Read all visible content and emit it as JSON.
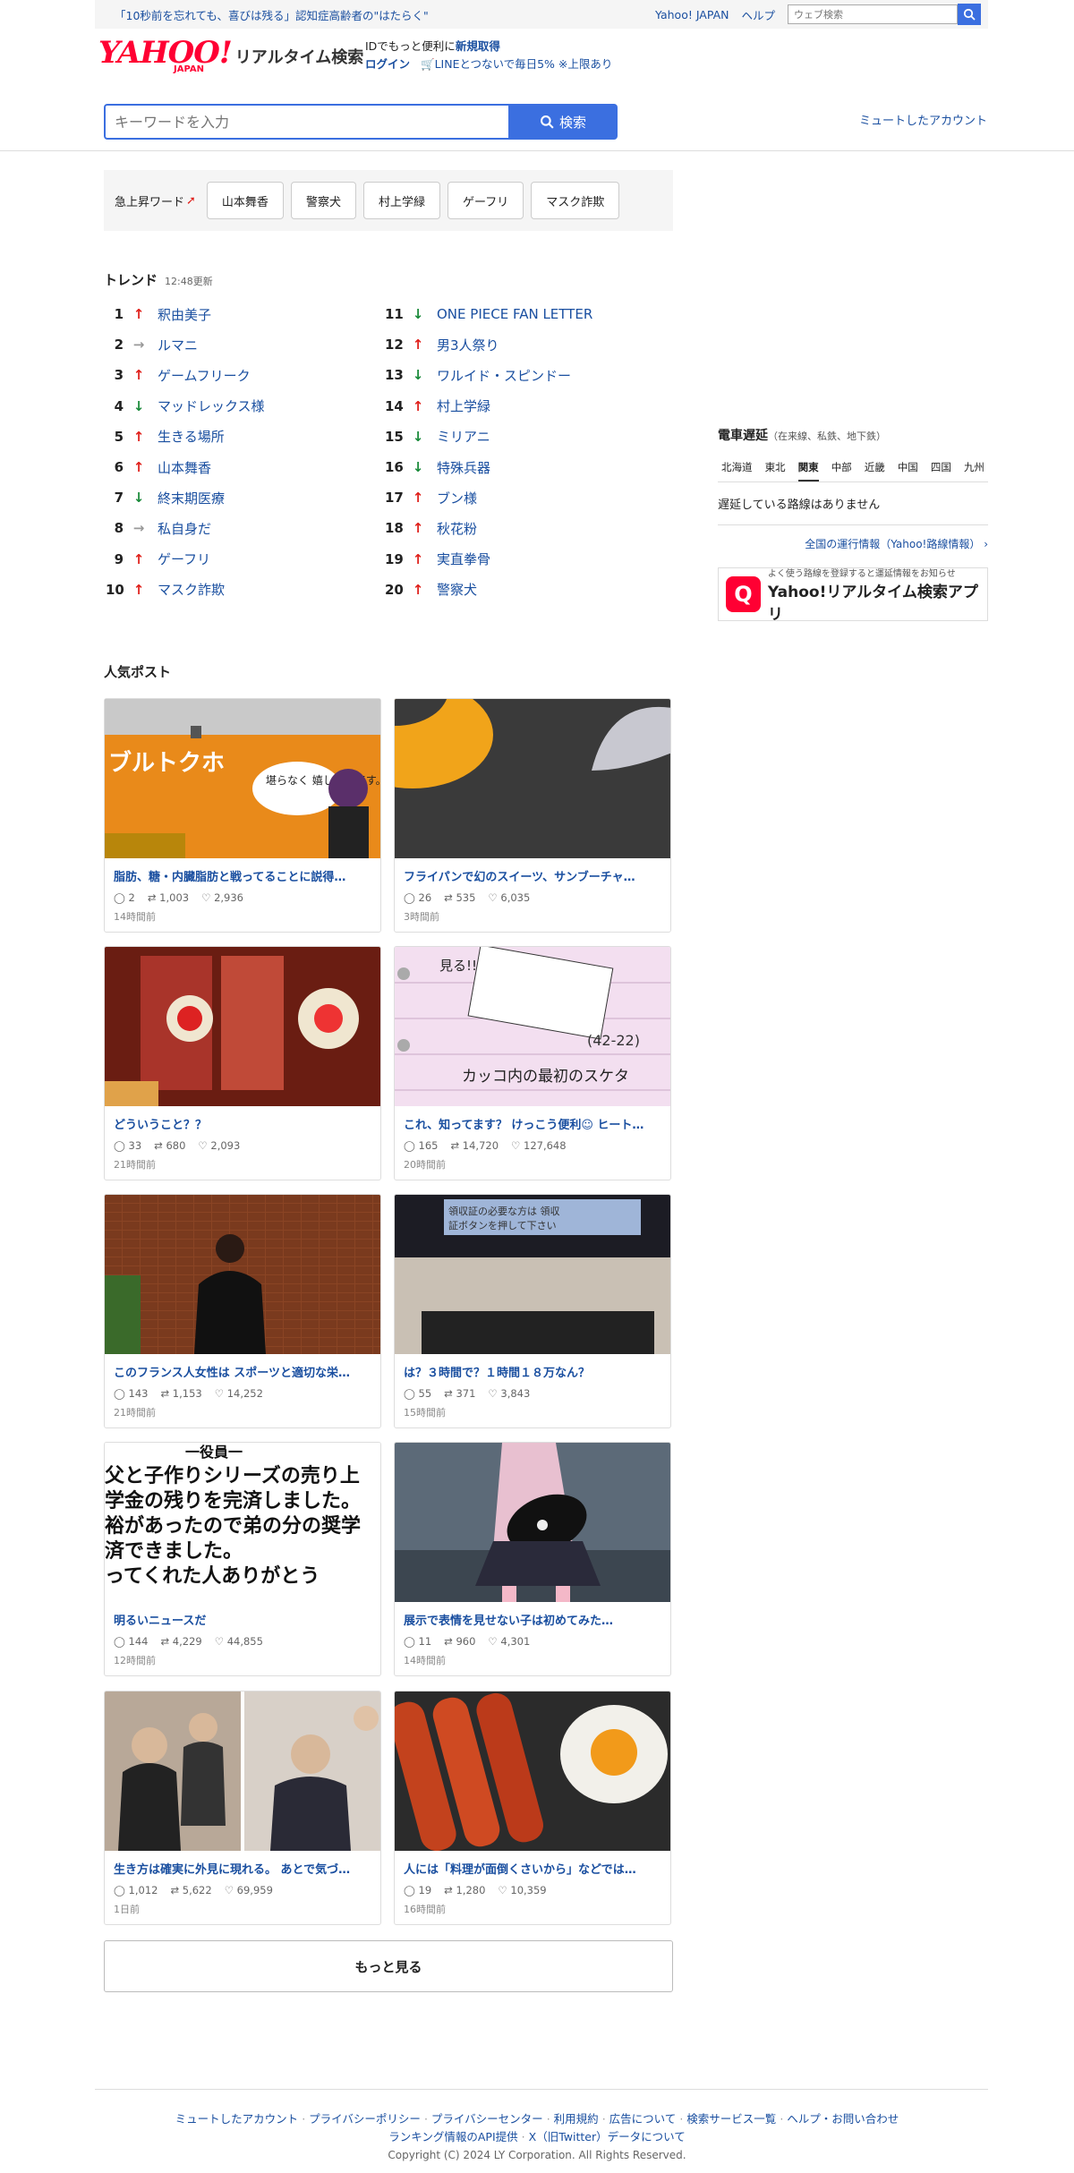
{
  "topbar": {
    "promo": "「10秒前を忘れても、喜びは残る」認知症高齢者の\"はたらく\"",
    "yahoo_japan": "Yahoo! JAPAN",
    "help": "ヘルプ",
    "web_search_placeholder": "ウェブ検索"
  },
  "logo": {
    "yahoo": "YAHOO!",
    "japan": "JAPAN",
    "service": "リアルタイム検索"
  },
  "idbox": {
    "line1_prefix": "IDでもっと便利に",
    "signup": "新規取得",
    "login": "ログイン",
    "line_promo": "LINEとつないで毎日5% ※上限あり"
  },
  "search": {
    "placeholder": "キーワードを入力",
    "button": "検索"
  },
  "muted_accounts": "ミュートしたアカウント",
  "surge": {
    "label": "急上昇ワード",
    "chips": [
      "山本舞香",
      "警察犬",
      "村上学緑",
      "ゲーフリ",
      "マスク詐欺"
    ]
  },
  "trend": {
    "title": "トレンド",
    "updated": "12:48更新",
    "left": [
      {
        "rank": "1",
        "dir": "up",
        "kw": "釈由美子"
      },
      {
        "rank": "2",
        "dir": "same",
        "kw": "ルマニ"
      },
      {
        "rank": "3",
        "dir": "up",
        "kw": "ゲームフリーク"
      },
      {
        "rank": "4",
        "dir": "down",
        "kw": "マッドレックス様"
      },
      {
        "rank": "5",
        "dir": "up",
        "kw": "生きる場所"
      },
      {
        "rank": "6",
        "dir": "up",
        "kw": "山本舞香"
      },
      {
        "rank": "7",
        "dir": "down",
        "kw": "終末期医療"
      },
      {
        "rank": "8",
        "dir": "same",
        "kw": "私自身だ"
      },
      {
        "rank": "9",
        "dir": "up",
        "kw": "ゲーフリ"
      },
      {
        "rank": "10",
        "dir": "up",
        "kw": "マスク詐欺"
      }
    ],
    "right": [
      {
        "rank": "11",
        "dir": "down",
        "kw": "ONE PIECE FAN LETTER"
      },
      {
        "rank": "12",
        "dir": "up",
        "kw": "男3人祭り"
      },
      {
        "rank": "13",
        "dir": "down",
        "kw": "ワルイド・スピンドー"
      },
      {
        "rank": "14",
        "dir": "up",
        "kw": "村上学緑"
      },
      {
        "rank": "15",
        "dir": "down",
        "kw": "ミリアニ"
      },
      {
        "rank": "16",
        "dir": "down",
        "kw": "特殊兵器"
      },
      {
        "rank": "17",
        "dir": "up",
        "kw": "ブン様"
      },
      {
        "rank": "18",
        "dir": "up",
        "kw": "秋花粉"
      },
      {
        "rank": "19",
        "dir": "up",
        "kw": "実直拳骨"
      },
      {
        "rank": "20",
        "dir": "up",
        "kw": "警察犬"
      }
    ]
  },
  "train": {
    "title": "電車遅延",
    "subtitle": "（在来線、私鉄、地下鉄）",
    "regions": [
      "北海道",
      "東北",
      "関東",
      "中部",
      "近畿",
      "中国",
      "四国",
      "九州"
    ],
    "selected_region": "関東",
    "status": "遅延している路線はありません",
    "link": "全国の運行情報（Yahoo!路線情報）",
    "app_small": "よく使う路線を登録すると運延情報をお知らせ",
    "app_name": "Yahoo!リアルタイム検索アプリ"
  },
  "posts": {
    "title": "人気ポスト",
    "items": [
      {
        "title": "脂肪、糖・内臓脂肪と戦ってることに説得…",
        "replies": "2",
        "retweets": "1,003",
        "likes": "2,936",
        "time": "14時間前",
        "img": "orange"
      },
      {
        "title": "フライパンで幻のスイーツ、サンブーチャ…",
        "replies": "26",
        "retweets": "535",
        "likes": "6,035",
        "time": "3時間前",
        "img": "pan"
      },
      {
        "title": "どういうこと？？",
        "replies": "33",
        "retweets": "680",
        "likes": "2,093",
        "time": "21時間前",
        "img": "arcade"
      },
      {
        "title": "これ、知ってます？ けっこう便利☺ ヒート…",
        "replies": "165",
        "retweets": "14,720",
        "likes": "127,648",
        "time": "20時間前",
        "img": "note"
      },
      {
        "title": "このフランス人女性は スポーツと適切な栄…",
        "replies": "143",
        "retweets": "1,153",
        "likes": "14,252",
        "time": "21時間前",
        "img": "woman"
      },
      {
        "title": "は？３時間で？１時間１８万なん？",
        "replies": "55",
        "retweets": "371",
        "likes": "3,843",
        "time": "15時間前",
        "img": "screen"
      },
      {
        "title": "明るいニュースだ",
        "replies": "144",
        "retweets": "4,229",
        "likes": "44,855",
        "time": "12時間前",
        "img": "text"
      },
      {
        "title": "展示で表情を見せない子は初めてみた…",
        "replies": "11",
        "retweets": "960",
        "likes": "4,301",
        "time": "14時間前",
        "img": "figure"
      },
      {
        "title": "生き方は確実に外見に現れる。 あとで気づ…",
        "replies": "1,012",
        "retweets": "5,622",
        "likes": "69,959",
        "time": "1日前",
        "img": "people"
      },
      {
        "title": "人には「料理が面倒くさいから」などでは…",
        "replies": "19",
        "retweets": "1,280",
        "likes": "10,359",
        "time": "16時間前",
        "img": "food"
      }
    ],
    "text_image_lines": [
      "一役員一",
      "父と子作りシリーズの売り上",
      "学金の残りを完済しました。",
      "裕があったので弟の分の奨学",
      "済できました。",
      "ってくれた人ありがとう"
    ],
    "screen_text": "領収証の必要な方は 領収証ボタンを押して下さい",
    "note_text": "カッコ内の最初のスケタ",
    "note_code": "(42-22)",
    "note_tag": "見る!!",
    "poster_text": "堪らなく 嬉しいのです。",
    "more": "もっと見る"
  },
  "footer": {
    "links_row1": [
      "ミュートしたアカウント",
      "プライバシーポリシー",
      "プライバシーセンター",
      "利用規約",
      "広告について",
      "検索サービス一覧",
      "ヘルプ・お問い合わせ"
    ],
    "links_row2": [
      "ランキング情報のAPI提供",
      "X（旧Twitter）データについて"
    ],
    "copyright": "Copyright (C) 2024 LY Corporation. All Rights Reserved."
  },
  "colors": {
    "accent": "#3b6fe0",
    "brand": "#ff0033",
    "link": "#1a4fa0",
    "up": "#e0201b",
    "down": "#1a8a3a"
  }
}
